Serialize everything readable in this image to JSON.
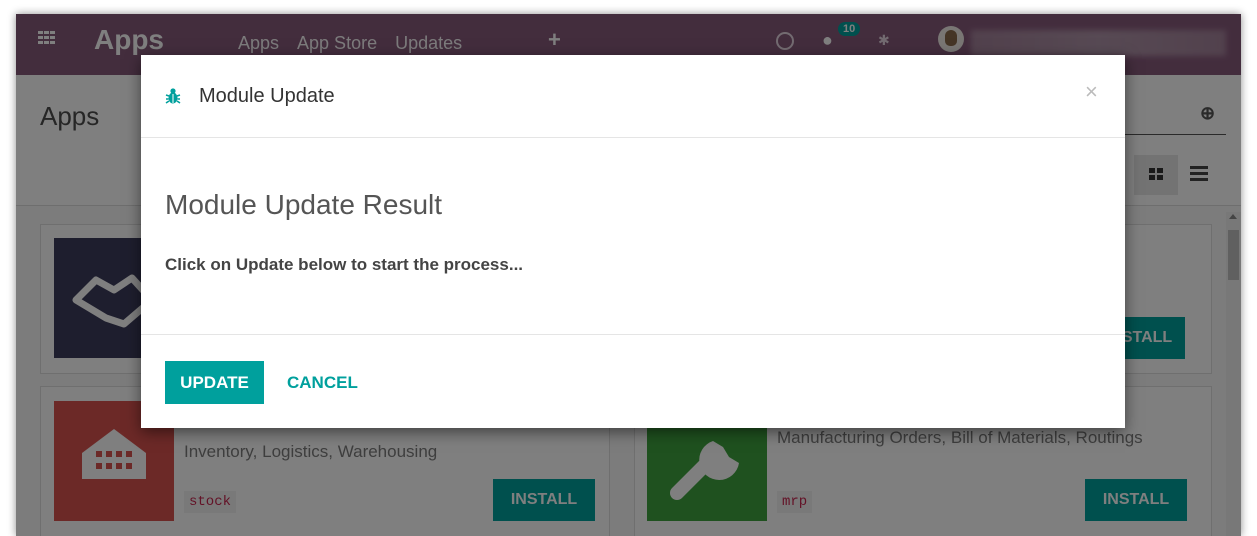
{
  "navbar": {
    "brand": "Apps",
    "links": [
      "Apps",
      "App Store",
      "Updates"
    ],
    "plus_icon": "+",
    "chat_badge": "10",
    "colors": {
      "navbar": "#875A7B",
      "accent": "#00A09D"
    }
  },
  "control_panel": {
    "title": "Apps"
  },
  "cards": [
    {
      "technical_name": "",
      "description": "",
      "install_label": "INSTALL",
      "icon": "handshake-icon",
      "color": "#3d3d5c"
    },
    {
      "technical_name": "stock",
      "description": "Inventory, Logistics, Warehousing",
      "install_label": "INSTALL",
      "icon": "warehouse-icon",
      "color": "#d9534f"
    },
    {
      "technical_name": "mrp",
      "description": "Manufacturing Orders, Bill of Materials, Routings",
      "install_label": "INSTALL",
      "icon": "wrench-icon",
      "color": "#3fa33f"
    }
  ],
  "partial_install_label": "STALL",
  "modal": {
    "title": "Module Update",
    "close_glyph": "×",
    "body_title": "Module Update Result",
    "body_text": "Click on Update below to start the process...",
    "update_label": "UPDATE",
    "cancel_label": "CANCEL"
  }
}
